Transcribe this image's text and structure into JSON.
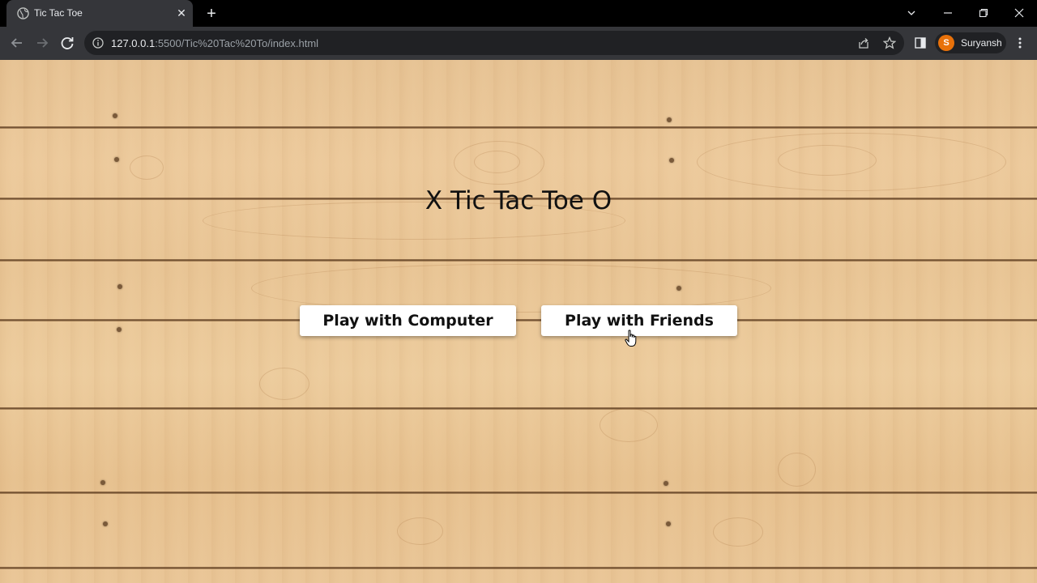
{
  "browser": {
    "tab_title": "Tic Tac Toe",
    "url_host": "127.0.0.1",
    "url_rest": ":5500/Tic%20Tac%20To/index.html",
    "profile_initial": "S",
    "profile_name": "Suryansh"
  },
  "page": {
    "title": "X Tic Tac Toe O",
    "buttons": {
      "computer": "Play with Computer",
      "friends": "Play with Friends"
    }
  },
  "colors": {
    "profile_accent": "#e8710a",
    "wood": "#e8c494"
  }
}
